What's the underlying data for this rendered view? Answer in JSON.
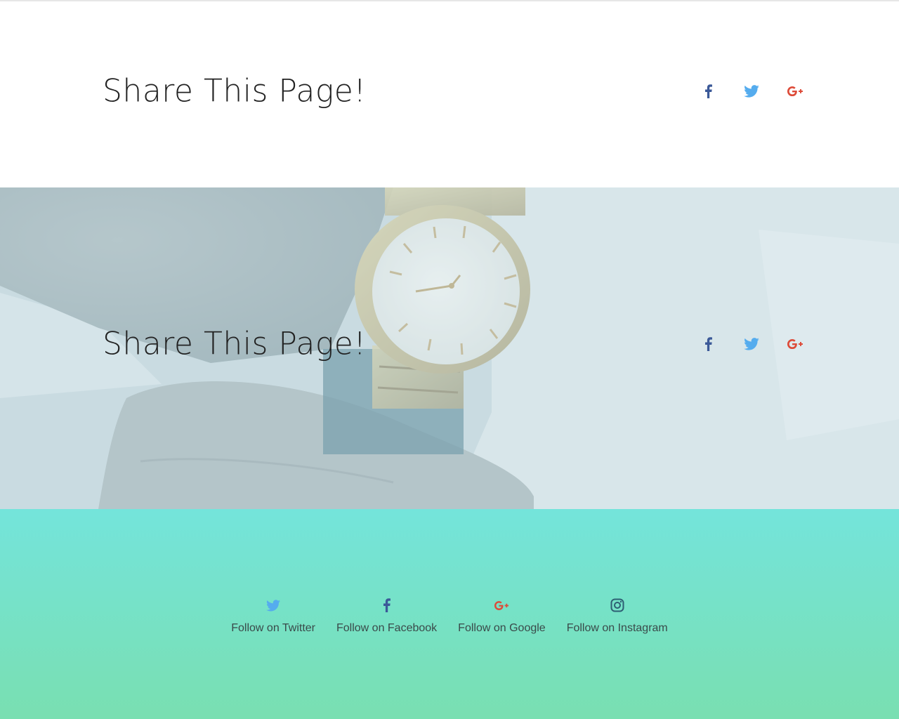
{
  "share_sections": [
    {
      "title": "Share This Page!"
    },
    {
      "title": "Share This Page!"
    }
  ],
  "share_icons": {
    "facebook": {
      "icon": "facebook-icon",
      "color": "#3b5998"
    },
    "twitter": {
      "icon": "twitter-icon",
      "color": "#55acee"
    },
    "google": {
      "icon": "google-plus-icon",
      "color": "#dd4b39"
    }
  },
  "footer": {
    "items": [
      {
        "label": "Follow on Twitter",
        "icon": "twitter-icon",
        "color": "#55acee"
      },
      {
        "label": "Follow on Facebook",
        "icon": "facebook-icon",
        "color": "#3b5998"
      },
      {
        "label": "Follow on Google",
        "icon": "google-plus-icon",
        "color": "#dd4b39"
      },
      {
        "label": "Follow on Instagram",
        "icon": "instagram-icon",
        "color": "#2e5e73"
      }
    ],
    "gradient": [
      "#74e4db",
      "#79dfb1"
    ]
  }
}
